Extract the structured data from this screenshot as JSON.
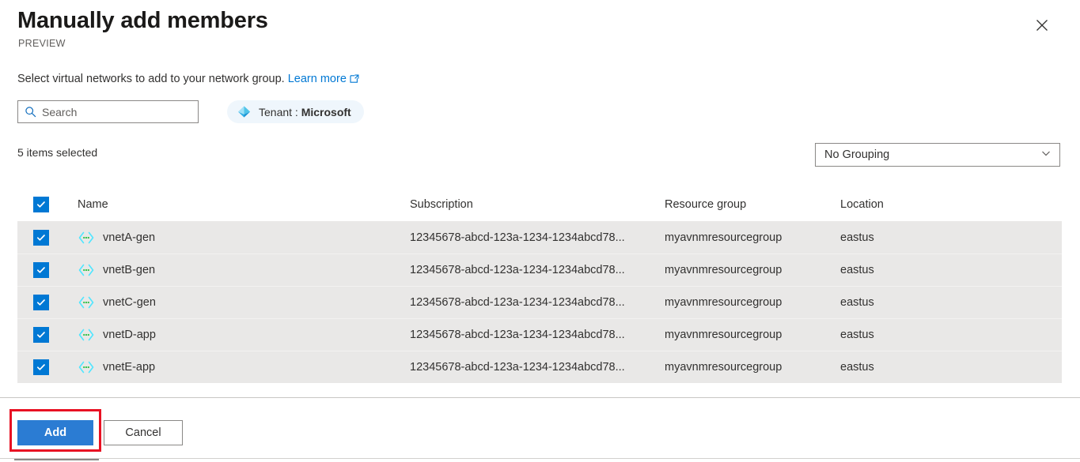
{
  "dialog": {
    "title": "Manually add members",
    "preview_label": "PREVIEW",
    "close_icon": "close-icon",
    "description": "Select virtual networks to add to your network group.",
    "learn_more_label": "Learn more",
    "external_link_icon": "external-link-icon"
  },
  "search": {
    "placeholder": "Search",
    "value": "",
    "icon": "search-icon"
  },
  "tenant_filter": {
    "icon": "azure-ad-diamond-icon",
    "prefix": "Tenant : ",
    "value": "Microsoft"
  },
  "toolbar": {
    "selection_count": "5 items selected",
    "grouping": {
      "selected": "No Grouping",
      "chevron_icon": "chevron-down-icon"
    }
  },
  "table": {
    "select_all_checked": true,
    "columns": {
      "name": "Name",
      "subscription": "Subscription",
      "resource_group": "Resource group",
      "location": "Location"
    },
    "rows": [
      {
        "checked": true,
        "icon": "virtual-network-icon",
        "name": "vnetA-gen",
        "subscription": "12345678-abcd-123a-1234-1234abcd78...",
        "resource_group": "myavnmresourcegroup",
        "location": "eastus"
      },
      {
        "checked": true,
        "icon": "virtual-network-icon",
        "name": "vnetB-gen",
        "subscription": "12345678-abcd-123a-1234-1234abcd78...",
        "resource_group": "myavnmresourcegroup",
        "location": "eastus"
      },
      {
        "checked": true,
        "icon": "virtual-network-icon",
        "name": "vnetC-gen",
        "subscription": "12345678-abcd-123a-1234-1234abcd78...",
        "resource_group": "myavnmresourcegroup",
        "location": "eastus"
      },
      {
        "checked": true,
        "icon": "virtual-network-icon",
        "name": "vnetD-app",
        "subscription": "12345678-abcd-123a-1234-1234abcd78...",
        "resource_group": "myavnmresourcegroup",
        "location": "eastus"
      },
      {
        "checked": true,
        "icon": "virtual-network-icon",
        "name": "vnetE-app",
        "subscription": "12345678-abcd-123a-1234-1234abcd78...",
        "resource_group": "myavnmresourcegroup",
        "location": "eastus"
      }
    ]
  },
  "footer": {
    "add_label": "Add",
    "cancel_label": "Cancel"
  },
  "colors": {
    "accent": "#0078d4",
    "primary_button": "#2b7cd3",
    "link": "#0078d4",
    "annotation": "#e81123",
    "row_selected_bg": "#e9e8e7",
    "tenant_pill_bg": "#eff6fc",
    "vnet_icon": "#50e6ff"
  }
}
